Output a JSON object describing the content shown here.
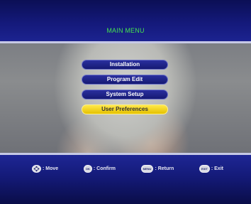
{
  "menu": {
    "title": "MAIN MENU",
    "items": [
      {
        "label": "Installation"
      },
      {
        "label": "Program Edit"
      },
      {
        "label": "System Setup"
      },
      {
        "label": "User Preferences",
        "selected": true
      }
    ]
  },
  "hints": [
    {
      "icon": "dpad-icon",
      "label": ": Move"
    },
    {
      "icon": "ok-key-icon",
      "key": "OK",
      "label": ": Confirm"
    },
    {
      "icon": "menu-key-icon",
      "key": "MENU",
      "label": ": Return"
    },
    {
      "icon": "exit-key-icon",
      "key": "EXIT",
      "label": ": Exit"
    }
  ],
  "colors": {
    "title": "#44e34f",
    "selected_item": "#f2d21e",
    "band": "#141a78"
  }
}
